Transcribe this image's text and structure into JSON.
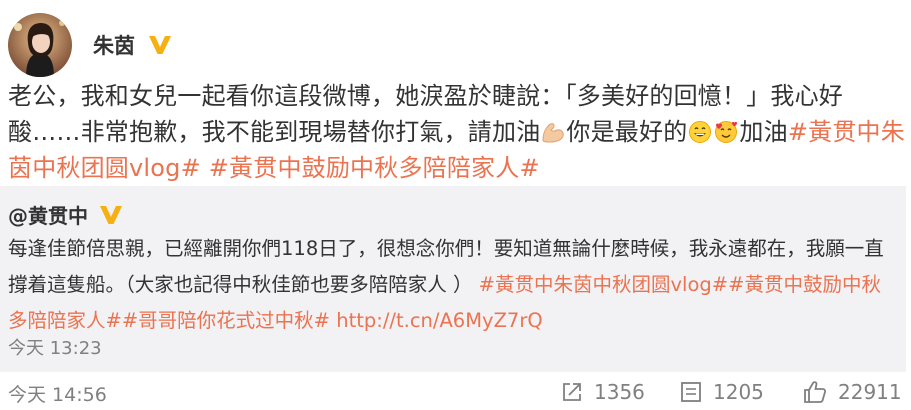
{
  "post": {
    "author": "朱茵",
    "text_part1": "老公，我和女兒一起看你這段微博，她淚盈於睫說：「多美好的回憶！」我心好酸……非常抱歉，我不能到現場替你打氣，請加油",
    "text_part2": "你是最好的",
    "text_part3": "加油",
    "tag1": "#黃贯中朱茵中秋团圆vlog#",
    "tag2": "#黃贯中鼓励中秋多陪陪家人#",
    "time": "今天 14:56",
    "icons": [
      "flexed-biceps-emoji",
      "grinning-face-emoji",
      "smiling-face-with-hearts-emoji"
    ]
  },
  "repost": {
    "author": "@黄贯中",
    "text": "每逢佳節倍思親，已經離開你們118日了，很想念你們！要知道無論什麼時候，我永遠都在，我願一直撐着這隻船。（大家也記得中秋佳節也要多陪陪家人 ）",
    "tags": "#黃贯中朱茵中秋团圆vlog##黃贯中鼓励中秋多陪陪家人##哥哥陪你花式过中秋#",
    "link": "http://t.cn/A6MyZ7rQ",
    "time": "今天 13:23"
  },
  "stats": {
    "reposts": "1356",
    "comments": "1205",
    "likes": "22911"
  },
  "colors": {
    "accent": "#eb7350",
    "verified_badge": "#f6b013",
    "muted": "#808080",
    "repost_bg": "#f2f2f5"
  }
}
